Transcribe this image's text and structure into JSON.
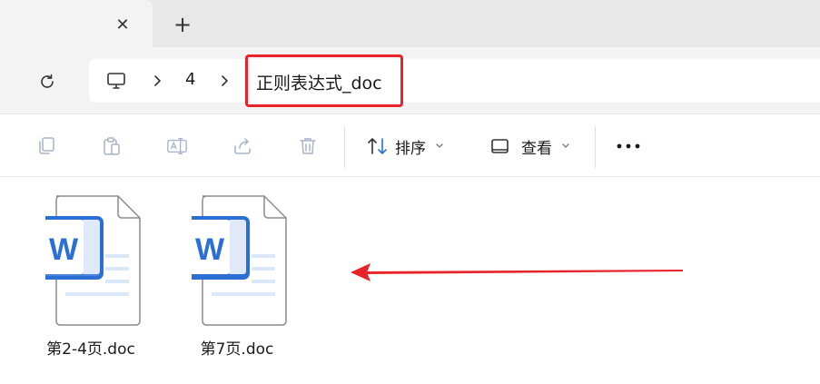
{
  "tabs": {
    "close_glyph": "✕",
    "new_tab_glyph": "+"
  },
  "breadcrumb": {
    "items": [
      "4",
      "正则表达式_doc"
    ]
  },
  "toolbar": {
    "sort_label": "排序",
    "view_label": "查看",
    "more_glyph": "•••"
  },
  "files": [
    {
      "name": "第2-4页.doc",
      "icon": "word-doc-icon"
    },
    {
      "name": "第7页.doc",
      "icon": "word-doc-icon"
    }
  ],
  "colors": {
    "highlight": "#e8232a",
    "word_blue": "#2b6fd6",
    "arrow_red": "#e8232a"
  }
}
